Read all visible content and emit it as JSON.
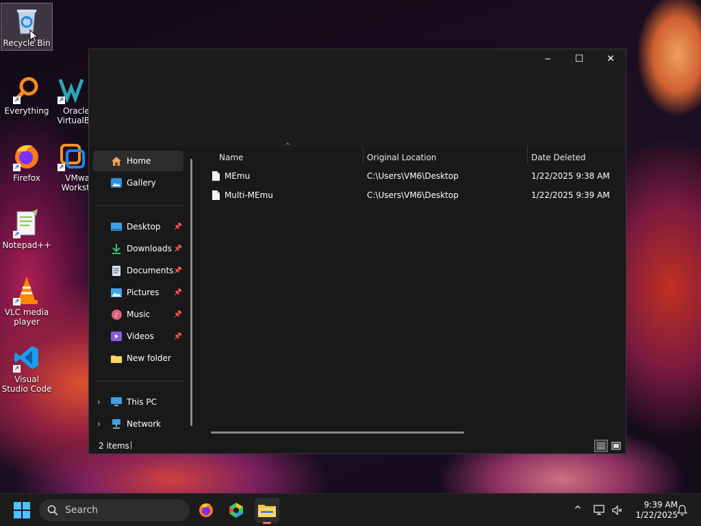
{
  "desktop": {
    "icons": [
      {
        "label": "Recycle Bin"
      },
      {
        "label": "Everything"
      },
      {
        "label": "Oracle VirtualB"
      },
      {
        "label": "Firefox"
      },
      {
        "label": "VMwa Workst"
      },
      {
        "label": "Notepad++"
      },
      {
        "label": "VLC media player"
      },
      {
        "label": "Visual Studio Code"
      }
    ]
  },
  "window": {
    "controls": {
      "minimize": "─",
      "maximize": "☐",
      "close": "✕"
    },
    "nav": {
      "home": "Home",
      "gallery": "Gallery",
      "desktop": "Desktop",
      "downloads": "Downloads",
      "documents": "Documents",
      "pictures": "Pictures",
      "music": "Music",
      "videos": "Videos",
      "new_folder": "New folder",
      "this_pc": "This PC",
      "network": "Network",
      "pin_glyph": "📌",
      "chevron": "›"
    },
    "columns": {
      "name": "Name",
      "original_location": "Original Location",
      "date_deleted": "Date Deleted",
      "sort_glyph": "^"
    },
    "rows": [
      {
        "name": "MEmu",
        "location": "C:\\Users\\VM6\\Desktop",
        "date": "1/22/2025 9:38 AM"
      },
      {
        "name": "Multi-MEmu",
        "location": "C:\\Users\\VM6\\Desktop",
        "date": "1/22/2025 9:39 AM"
      }
    ],
    "status": {
      "count": "2 items"
    }
  },
  "taskbar": {
    "search_label": "Search",
    "clock_time": "9:39 AM",
    "clock_date": "1/22/2025",
    "tray_chevron": "^"
  },
  "colors": {
    "accent": "#0078d4",
    "folder": "#f5c342",
    "window_bg": "#191919"
  }
}
